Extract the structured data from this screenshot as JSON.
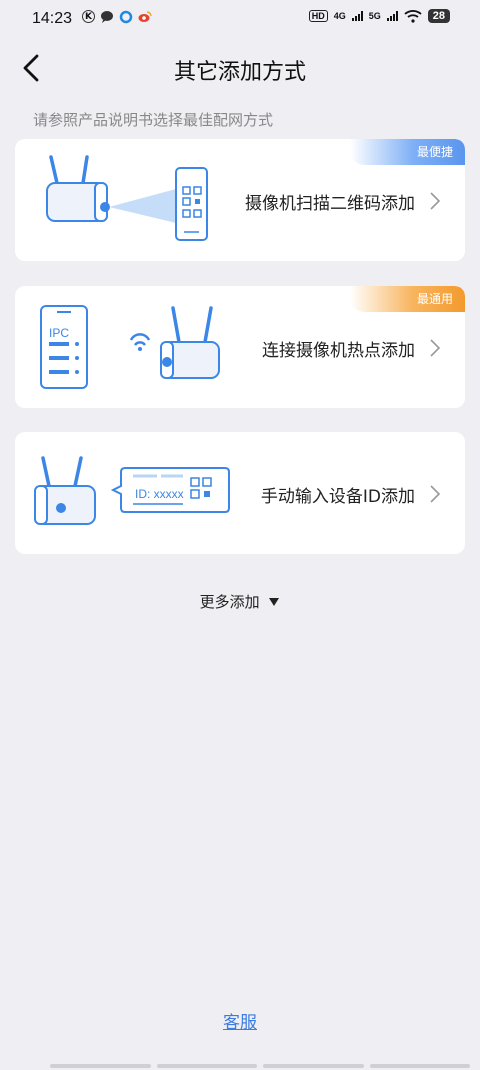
{
  "status_bar": {
    "time": "14:23",
    "hd_label": "HD",
    "net1": "4G",
    "net2": "5G",
    "battery": "28"
  },
  "header": {
    "title": "其它添加方式"
  },
  "hint": "请参照产品说明书选择最佳配网方式",
  "options": [
    {
      "label": "摄像机扫描二维码添加",
      "badge": "最便捷",
      "badge_color": "#5a95ee"
    },
    {
      "label": "连接摄像机热点添加",
      "badge": "最通用",
      "badge_color": "#f39a2e"
    },
    {
      "label": "手动输入设备ID添加",
      "illustration_text": "ID: xxxxx"
    }
  ],
  "phone_text": "IPC",
  "more_add": "更多添加",
  "customer_service": "客服",
  "colors": {
    "accent": "#3c7be0",
    "background": "#efeef3",
    "illustration_blue": "#3b86e6"
  }
}
